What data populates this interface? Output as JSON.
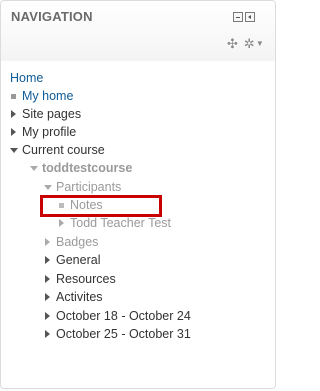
{
  "block": {
    "title": "NAVIGATION",
    "controls": {
      "minimize_icon": "minus-box-icon",
      "dock_icon": "dock-arrow-icon"
    },
    "edit": {
      "move_icon": "move-icon",
      "settings_icon": "gear-icon",
      "move_glyph": "✣",
      "settings_glyph": "✲",
      "caret_glyph": "▼"
    }
  },
  "nav": {
    "home": "Home",
    "my_home": "My home",
    "site_pages": "Site pages",
    "my_profile": "My profile",
    "current_course": "Current course",
    "course": "toddtestcourse",
    "participants": "Participants",
    "notes": "Notes",
    "teacher": "Todd Teacher Test",
    "badges": "Badges",
    "general": "General",
    "resources": "Resources",
    "activites": "Activites",
    "week1": "October 18 - October 24",
    "week2": "October 25 - October 31"
  },
  "colors": {
    "link": "#0f5c9a",
    "highlight": "#c90000",
    "muted": "#9a9a9a"
  }
}
